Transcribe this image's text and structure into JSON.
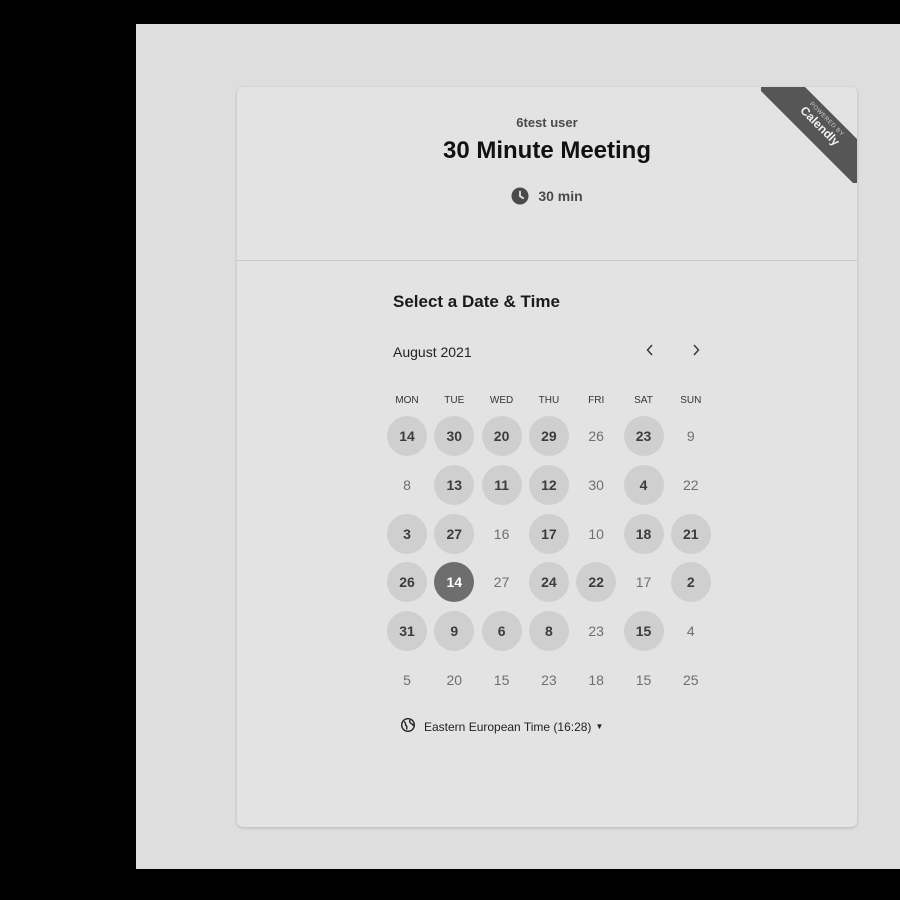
{
  "event": {
    "owner": "6test user",
    "title": "30 Minute Meeting",
    "duration": "30 min",
    "duration_icon": "clock-icon"
  },
  "ribbon": {
    "line1": "POWERED BY",
    "line2": "Calendly"
  },
  "calendar": {
    "heading": "Select a Date & Time",
    "month": "August 2021",
    "prev_icon": "chevron-left-icon",
    "next_icon": "chevron-right-icon",
    "weekdays": [
      "MON",
      "TUE",
      "WED",
      "THU",
      "FRI",
      "SAT",
      "SUN"
    ],
    "weeks": [
      [
        {
          "label": "14",
          "state": "available"
        },
        {
          "label": "30",
          "state": "available"
        },
        {
          "label": "20",
          "state": "available"
        },
        {
          "label": "29",
          "state": "available"
        },
        {
          "label": "26",
          "state": "unavailable"
        },
        {
          "label": "23",
          "state": "available"
        },
        {
          "label": "9",
          "state": "unavailable"
        }
      ],
      [
        {
          "label": "8",
          "state": "unavailable"
        },
        {
          "label": "13",
          "state": "available"
        },
        {
          "label": "11",
          "state": "available"
        },
        {
          "label": "12",
          "state": "available"
        },
        {
          "label": "30",
          "state": "unavailable"
        },
        {
          "label": "4",
          "state": "available"
        },
        {
          "label": "22",
          "state": "unavailable"
        }
      ],
      [
        {
          "label": "3",
          "state": "available"
        },
        {
          "label": "27",
          "state": "available"
        },
        {
          "label": "16",
          "state": "unavailable"
        },
        {
          "label": "17",
          "state": "available"
        },
        {
          "label": "10",
          "state": "unavailable"
        },
        {
          "label": "18",
          "state": "available"
        },
        {
          "label": "21",
          "state": "available"
        }
      ],
      [
        {
          "label": "26",
          "state": "available"
        },
        {
          "label": "14",
          "state": "selected"
        },
        {
          "label": "27",
          "state": "unavailable"
        },
        {
          "label": "24",
          "state": "available"
        },
        {
          "label": "22",
          "state": "available"
        },
        {
          "label": "17",
          "state": "unavailable"
        },
        {
          "label": "2",
          "state": "available"
        }
      ],
      [
        {
          "label": "31",
          "state": "available"
        },
        {
          "label": "9",
          "state": "available"
        },
        {
          "label": "6",
          "state": "available"
        },
        {
          "label": "8",
          "state": "available"
        },
        {
          "label": "23",
          "state": "unavailable"
        },
        {
          "label": "15",
          "state": "available"
        },
        {
          "label": "4",
          "state": "unavailable"
        }
      ],
      [
        {
          "label": "5",
          "state": "unavailable"
        },
        {
          "label": "20",
          "state": "unavailable"
        },
        {
          "label": "15",
          "state": "unavailable"
        },
        {
          "label": "23",
          "state": "unavailable"
        },
        {
          "label": "18",
          "state": "unavailable"
        },
        {
          "label": "15",
          "state": "unavailable"
        },
        {
          "label": "25",
          "state": "unavailable"
        }
      ]
    ]
  },
  "timezone": {
    "label": "Eastern European Time (16:28)",
    "icon": "globe-icon",
    "caret_icon": "caret-down-icon"
  }
}
